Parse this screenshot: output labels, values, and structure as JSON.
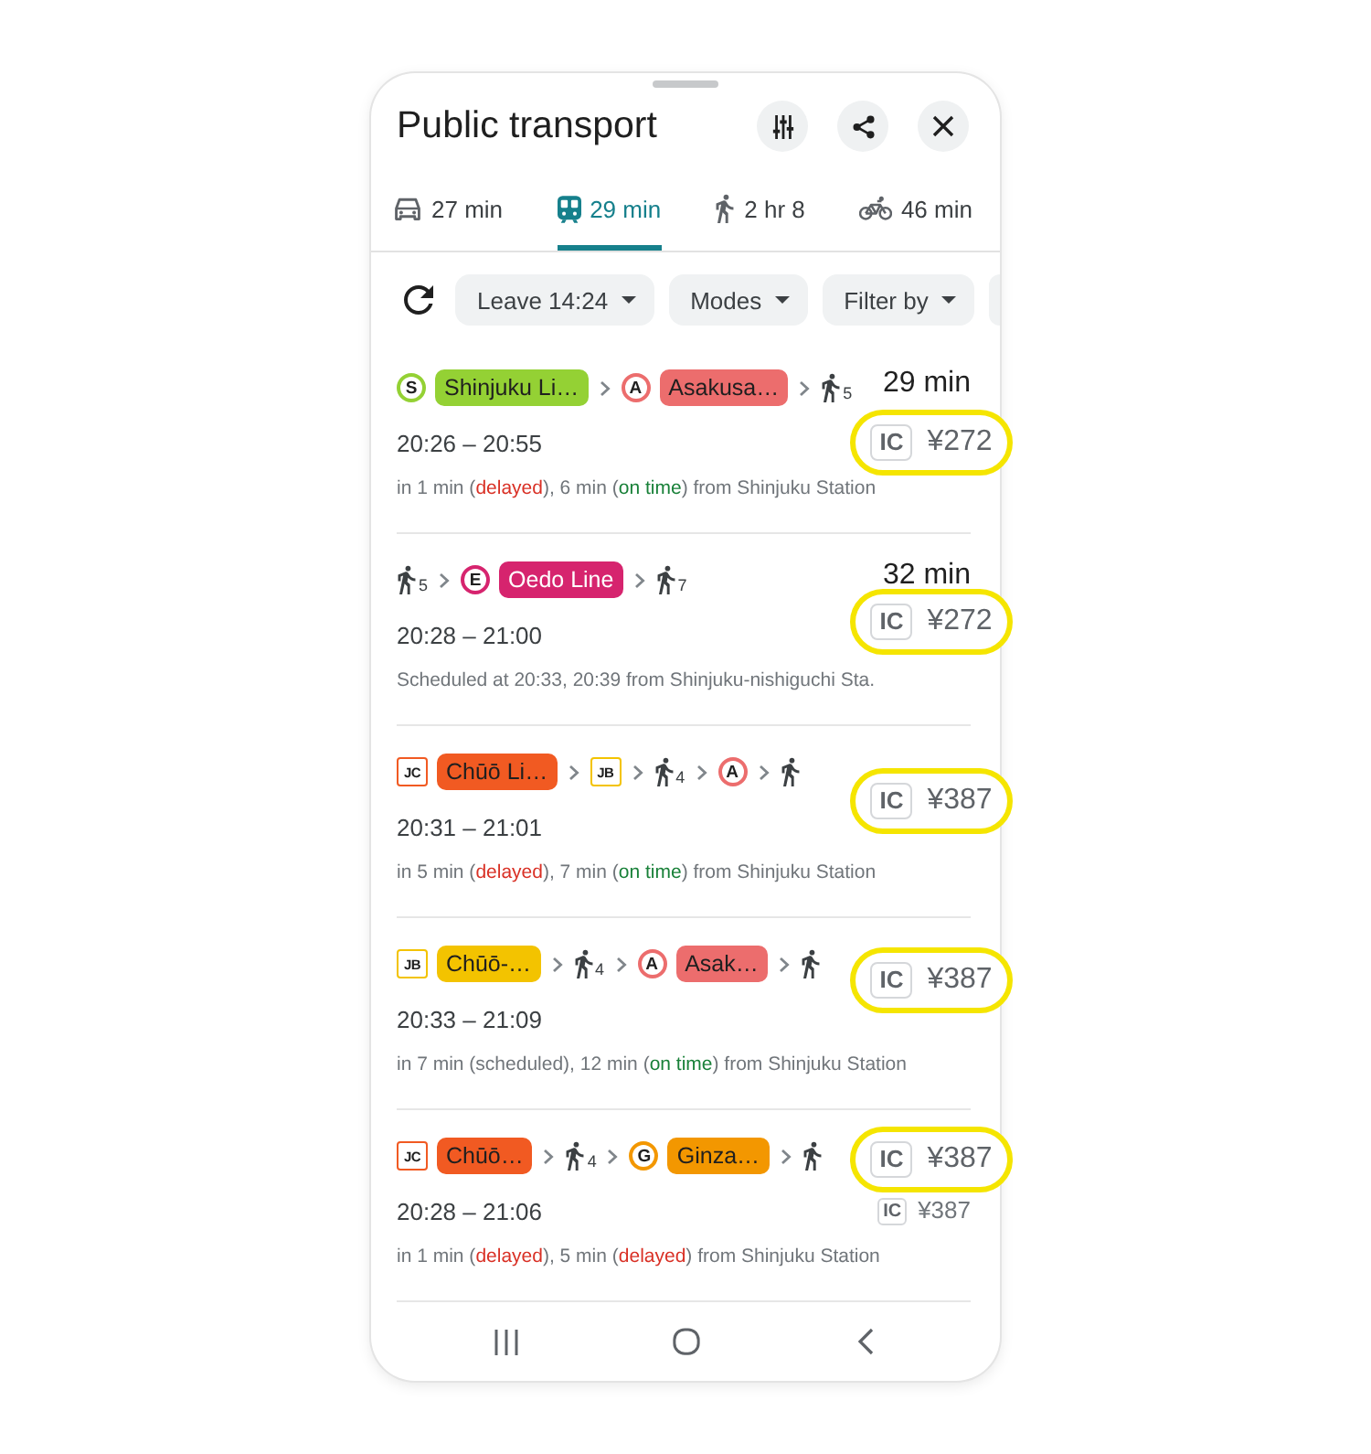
{
  "sheet": {
    "title": "Public transport"
  },
  "tabs": [
    {
      "kind": "car",
      "label": "27 min",
      "selected": false
    },
    {
      "kind": "transit",
      "label": "29 min",
      "selected": true
    },
    {
      "kind": "walk",
      "label": "2 hr 8",
      "selected": false
    },
    {
      "kind": "bike",
      "label": "46 min",
      "selected": false
    }
  ],
  "filters": [
    {
      "label": "Leave 14:24"
    },
    {
      "label": "Modes"
    },
    {
      "label": "Filter by"
    }
  ],
  "routes": [
    {
      "segments": [
        {
          "kind": "circle",
          "badge": "S",
          "color": "#94d134",
          "name": "Shinjuku Li…"
        },
        {
          "kind": "circle",
          "badge": "A",
          "color": "#ec6d6d",
          "name": "Asakusa…"
        },
        {
          "kind": "walk",
          "minutes": "5"
        }
      ],
      "duration": "29 min",
      "times": "20:26 – 20:55",
      "detail": [
        {
          "kind": "text",
          "text": "in 1 min ("
        },
        {
          "kind": "delayed",
          "text": "delayed"
        },
        {
          "kind": "text",
          "text": "), 6 min ("
        },
        {
          "kind": "on_time",
          "text": "on time"
        },
        {
          "kind": "text",
          "text": ") from Shinjuku Station"
        }
      ]
    },
    {
      "segments": [
        {
          "kind": "walk",
          "minutes": "5"
        },
        {
          "kind": "circle",
          "badge": "E",
          "color": "#d6246e",
          "name": "Oedo Line"
        },
        {
          "kind": "walk",
          "minutes": "7"
        }
      ],
      "duration": "32 min",
      "times": "20:28 – 21:00",
      "detail": [
        {
          "kind": "text",
          "text": "Scheduled at 20:33, 20:39 from Shinjuku-nishiguchi Sta."
        }
      ]
    },
    {
      "segments": [
        {
          "kind": "square",
          "badge": "JC",
          "color": "#f15a22",
          "name": "Chūō Li…"
        },
        {
          "kind": "square",
          "badge": "JB",
          "color": "#f3c300"
        },
        {
          "kind": "walk",
          "minutes": "4"
        },
        {
          "kind": "circle",
          "badge": "A",
          "color": "#ec6d6d"
        },
        {
          "kind": "walk"
        }
      ],
      "times": "20:31 – 21:01",
      "detail": [
        {
          "kind": "text",
          "text": "in 5 min ("
        },
        {
          "kind": "delayed",
          "text": "delayed"
        },
        {
          "kind": "text",
          "text": "), 7 min ("
        },
        {
          "kind": "on_time",
          "text": "on time"
        },
        {
          "kind": "text",
          "text": ") from Shinjuku Station"
        }
      ]
    },
    {
      "segments": [
        {
          "kind": "square",
          "badge": "JB",
          "color": "#f3c300",
          "name": "Chūō-…"
        },
        {
          "kind": "walk",
          "minutes": "4"
        },
        {
          "kind": "circle",
          "badge": "A",
          "color": "#ec6d6d",
          "name": "Asak…"
        },
        {
          "kind": "walk"
        }
      ],
      "times": "20:33 – 21:09",
      "detail": [
        {
          "kind": "text",
          "text": "in 7 min (scheduled), 12 min ("
        },
        {
          "kind": "on_time",
          "text": "on time"
        },
        {
          "kind": "text",
          "text": ") from Shinjuku Station"
        }
      ]
    },
    {
      "segments": [
        {
          "kind": "square",
          "badge": "JC",
          "color": "#f15a22",
          "name": "Chūō…"
        },
        {
          "kind": "walk",
          "minutes": "4"
        },
        {
          "kind": "circle",
          "badge": "G",
          "color": "#f39700",
          "name": "Ginza…"
        },
        {
          "kind": "walk"
        }
      ],
      "times": "20:28 – 21:06",
      "fare": {
        "badge": "IC",
        "amount": "¥387"
      },
      "detail": [
        {
          "kind": "text",
          "text": "in 1 min ("
        },
        {
          "kind": "delayed",
          "text": "delayed"
        },
        {
          "kind": "text",
          "text": "), 5 min ("
        },
        {
          "kind": "delayed",
          "text": "delayed"
        },
        {
          "kind": "text",
          "text": ") from Shinjuku Station"
        }
      ]
    }
  ],
  "callouts": [
    {
      "badge": "IC",
      "fare": "¥272"
    },
    {
      "badge": "IC",
      "fare": "¥272"
    },
    {
      "badge": "IC",
      "fare": "¥387"
    },
    {
      "badge": "IC",
      "fare": "¥387"
    },
    {
      "badge": "IC",
      "fare": "¥387"
    }
  ]
}
